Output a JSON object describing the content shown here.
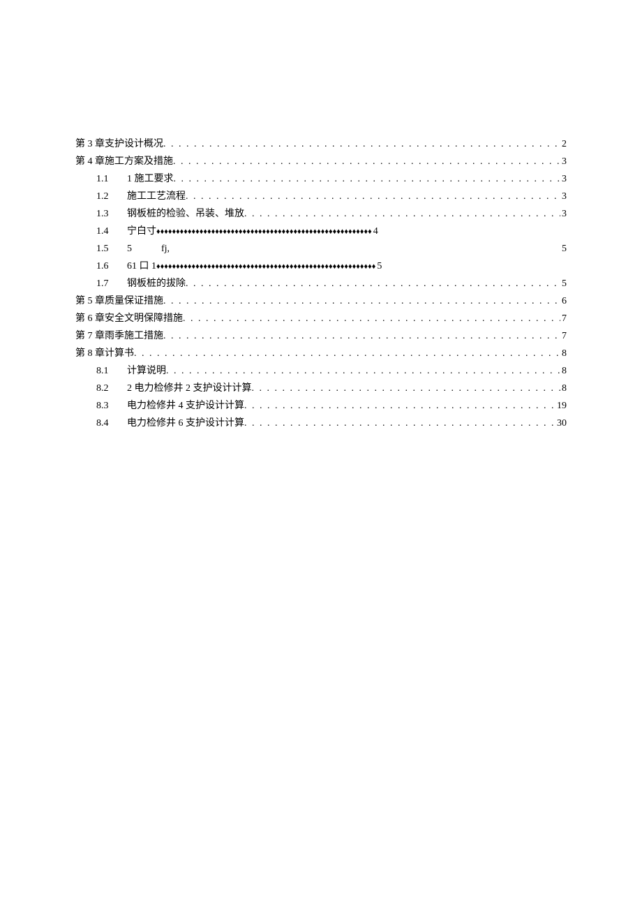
{
  "toc": [
    {
      "level": 1,
      "num": "",
      "label": "第 3 章支护设计概况",
      "leader": "dots",
      "page": "2"
    },
    {
      "level": 1,
      "num": "",
      "label": "第 4 章施工方案及措施",
      "leader": "dots",
      "page": "3"
    },
    {
      "level": 2,
      "num": "1.1",
      "label": "1 施工要求",
      "leader": "dots",
      "page": "3"
    },
    {
      "level": 2,
      "num": "1.2",
      "label": "施工工艺流程",
      "leader": "dots",
      "page": "3"
    },
    {
      "level": 2,
      "num": "1.3",
      "label": "钢板桩的检验、吊装、堆放",
      "leader": "dots",
      "page": "3"
    },
    {
      "level": 2,
      "num": "1.4",
      "label": "宁白寸",
      "leader": "diamonds",
      "page": "4",
      "diamond": "♦♦♦♦♦♦♦♦♦♦♦♦♦♦♦♦♦♦♦♦♦♦♦♦♦♦♦♦♦♦♦♦♦♦♦♦♦♦♦♦♦♦♦♦♦♦♦♦♦♦♦♦♦♦♦"
    },
    {
      "level": 2,
      "num": "1.5",
      "label": "5   fj,",
      "leader": "none",
      "page": "5"
    },
    {
      "level": 2,
      "num": "1.6",
      "label": "61 口 1",
      "leader": "diamonds",
      "page": "5",
      "diamond": "♦♦♦♦♦♦♦♦♦♦♦♦♦♦♦♦♦♦♦♦♦♦♦♦♦♦♦♦♦♦♦♦♦♦♦♦♦♦♦♦♦♦♦♦♦♦♦♦♦♦♦♦♦♦♦♦"
    },
    {
      "level": 2,
      "num": "1.7",
      "label": "钢板桩的拔除",
      "leader": "dots",
      "page": "5"
    },
    {
      "level": 1,
      "num": "",
      "label": "第 5 章质量保证措施",
      "leader": "dots",
      "page": "6"
    },
    {
      "level": 1,
      "num": "",
      "label": "第 6 章安全文明保障措施",
      "leader": "dots",
      "page": "7"
    },
    {
      "level": 1,
      "num": "",
      "label": "第 7 章雨季施工措施",
      "leader": "dots",
      "page": "7"
    },
    {
      "level": 1,
      "num": "",
      "label": "第 8 章计算书",
      "leader": "dots",
      "page": "8"
    },
    {
      "level": 2,
      "num": "8.1",
      "label": "计算说明",
      "leader": "dots",
      "page": "8"
    },
    {
      "level": 2,
      "num": "8.2",
      "label": "2 电力检修井 2 支护设计计算",
      "leader": "dots",
      "page": "8"
    },
    {
      "level": 2,
      "num": "8.3",
      "label": "电力检修井 4 支护设计计算",
      "leader": "dots",
      "page": "19"
    },
    {
      "level": 2,
      "num": "8.4",
      "label": "电力检修井 6 支护设计计算",
      "leader": "dots",
      "page": "30"
    }
  ]
}
